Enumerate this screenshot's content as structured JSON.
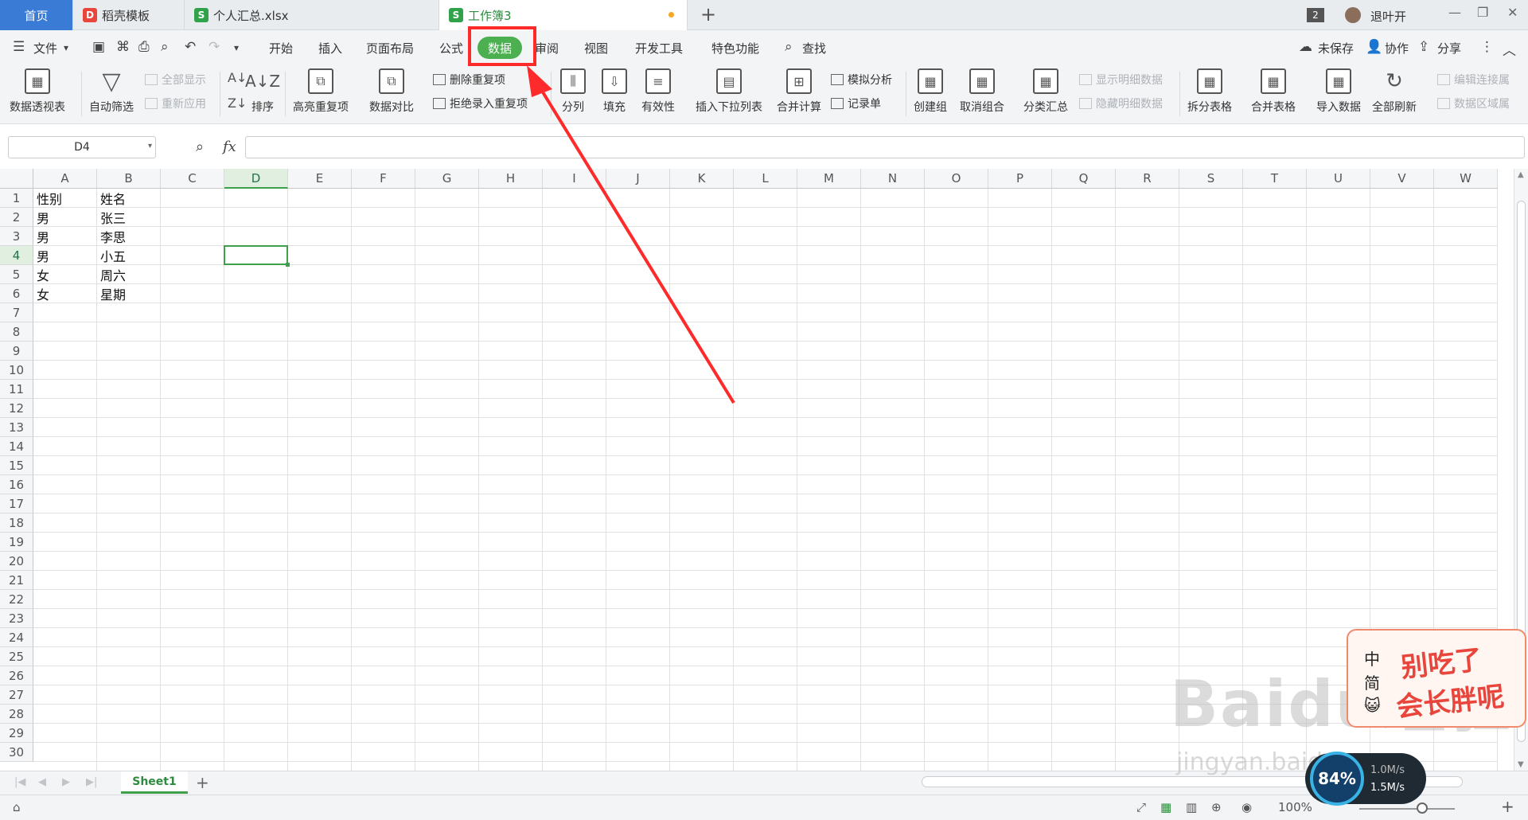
{
  "tabs": {
    "home": "首页",
    "template": "稻壳模板",
    "file1": "个人汇总.xlsx",
    "active": "工作簿3"
  },
  "window": {
    "badge": "2",
    "user": "退叶开"
  },
  "menu": {
    "file": "文件",
    "items": [
      "开始",
      "插入",
      "页面布局",
      "公式",
      "数据",
      "审阅",
      "视图",
      "开发工具",
      "特色功能"
    ],
    "active": "数据",
    "search": "查找",
    "unsaved": "未保存",
    "collab": "协作",
    "share": "分享"
  },
  "ribbon": {
    "pivot": "数据透视表",
    "autofilter": "自动筛选",
    "show_all": "全部显示",
    "reapply": "重新应用",
    "sort": "排序",
    "highlight_dup": "高亮重复项",
    "compare": "数据对比",
    "delete_dup": "删除重复项",
    "reject_dup": "拒绝录入重复项",
    "split": "分列",
    "fill": "填充",
    "validity": "有效性",
    "insert_dropdown": "插入下拉列表",
    "merge_calc": "合并计算",
    "simulate": "模拟分析",
    "record": "记录单",
    "create_group": "创建组",
    "ungroup": "取消组合",
    "subtotal": "分类汇总",
    "show_detail": "显示明细数据",
    "hide_detail": "隐藏明细数据",
    "split_table": "拆分表格",
    "merge_table": "合并表格",
    "import": "导入数据",
    "refresh_all": "全部刷新",
    "edit_link": "编辑连接属",
    "data_range": "数据区域属"
  },
  "formula": {
    "namebox": "D4",
    "fx": "fx",
    "value": ""
  },
  "sheet": {
    "columns": [
      "A",
      "B",
      "C",
      "D",
      "E",
      "F",
      "G",
      "H",
      "I",
      "J",
      "K",
      "L",
      "M",
      "N",
      "O",
      "P",
      "Q",
      "R",
      "S",
      "T",
      "U",
      "V",
      "W"
    ],
    "rows": [
      "1",
      "2",
      "3",
      "4",
      "5",
      "6",
      "7",
      "8",
      "9",
      "10",
      "11",
      "12",
      "13",
      "14",
      "15",
      "16",
      "17",
      "18",
      "19",
      "20",
      "21",
      "22",
      "23",
      "24",
      "25",
      "26",
      "27",
      "28",
      "29",
      "30"
    ],
    "selected_col": "D",
    "selected_row": "4",
    "cells": {
      "A1": "性别",
      "B1": "姓名",
      "A2": "男",
      "B2": "张三",
      "A3": "男",
      "B3": "李思",
      "A4": "男",
      "B4": "小五",
      "A5": "女",
      "B5": "周六",
      "A6": "女",
      "B6": "星期"
    }
  },
  "sheetbar": {
    "tab": "Sheet1",
    "add": "+"
  },
  "status": {
    "zoom": "100%"
  },
  "overlay": {
    "sticker_side": [
      "中",
      "简"
    ],
    "sticker_line1": "别吃了",
    "sticker_line2": "会长胖呢",
    "speed_percent": "84%",
    "speed_up": "1.0M/s",
    "speed_down": "1.5M/s",
    "watermark": "Baidu经验",
    "watermark_url": "jingyan.baidu.com"
  },
  "colors": {
    "accent_green": "#4caf50",
    "highlight_red": "#ff2a2a",
    "home_tab_blue": "#3a7bd5"
  }
}
